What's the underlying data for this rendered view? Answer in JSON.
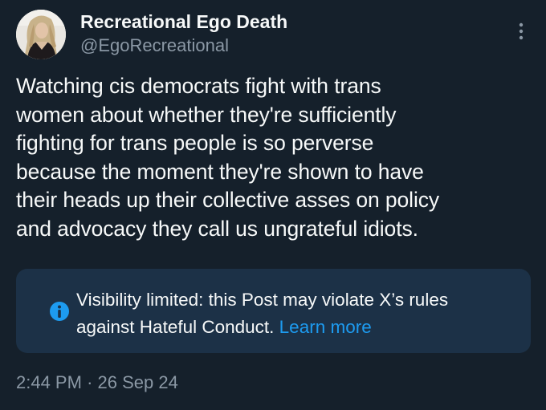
{
  "author": {
    "display_name": "Recreational Ego Death",
    "handle": "@EgoRecreational",
    "avatar": "profile-photo"
  },
  "menu_icon": "more-vertical-icon",
  "post": {
    "lines": [
      "Watching cis democrats fight with trans",
      "women about whether they're sufficiently",
      "fighting for trans people is so perverse",
      "because the moment they're shown to have",
      "their heads up their collective asses on policy",
      "and advocacy they call us ungrateful idiots."
    ]
  },
  "notice": {
    "icon": "info-icon",
    "line1": "Visibility limited: this Post may violate X’s rules",
    "line2": "against Hateful Conduct.",
    "link": "Learn more"
  },
  "timestamp": {
    "time": "2:44 PM",
    "separator": "·",
    "date": "26 Sep 24"
  },
  "colors": {
    "background": "#15202b",
    "text": "#f7f9f9",
    "secondary": "#8b98a5",
    "notice_bg": "#1c3147",
    "accent": "#1d9bf0"
  }
}
